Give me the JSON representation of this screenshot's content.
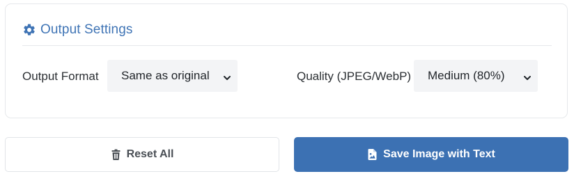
{
  "output_settings": {
    "title": "Output Settings",
    "icon": "gear-icon",
    "output_format": {
      "label": "Output Format",
      "selected": "Same as original"
    },
    "quality": {
      "label": "Quality (JPEG/WebP)",
      "selected": "Medium (80%)"
    }
  },
  "actions": {
    "reset_label": "Reset All",
    "reset_icon": "trash-icon",
    "save_label": "Save Image with Text",
    "save_icon": "file-image-icon"
  },
  "colors": {
    "accent": "#3c71b3",
    "heading": "#3f74b5"
  }
}
